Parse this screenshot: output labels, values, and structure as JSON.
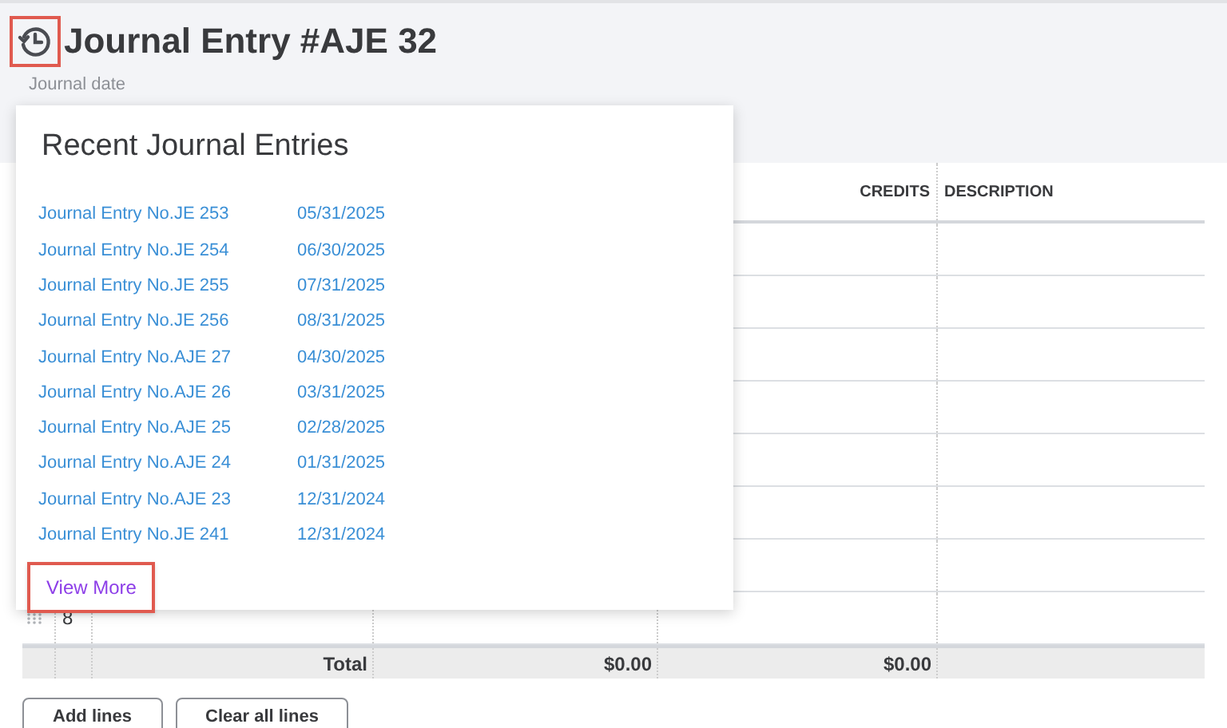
{
  "header": {
    "title": "Journal Entry #AJE 32",
    "date_label": "Journal date"
  },
  "recent_popup": {
    "title": "Recent Journal Entries",
    "entries": [
      {
        "name": "Journal Entry No.JE 253",
        "date": "05/31/2025"
      },
      {
        "name": "Journal Entry No.JE 254",
        "date": "06/30/2025"
      },
      {
        "name": "Journal Entry No.JE 255",
        "date": "07/31/2025"
      },
      {
        "name": "Journal Entry No.JE 256",
        "date": "08/31/2025"
      },
      {
        "name": "Journal Entry No.AJE 27",
        "date": "04/30/2025"
      },
      {
        "name": "Journal Entry No.AJE 26",
        "date": "03/31/2025"
      },
      {
        "name": "Journal Entry No.AJE 25",
        "date": "02/28/2025"
      },
      {
        "name": "Journal Entry No.AJE 24",
        "date": "01/31/2025"
      },
      {
        "name": "Journal Entry No.AJE 23",
        "date": "12/31/2024"
      },
      {
        "name": "Journal Entry No.JE 241",
        "date": "12/31/2024"
      }
    ],
    "view_more": "View More"
  },
  "table": {
    "columns": [
      "CREDITS",
      "DESCRIPTION"
    ],
    "visible_row": {
      "number": "8"
    },
    "total": {
      "label": "Total",
      "debits": "$0.00",
      "credits": "$0.00"
    }
  },
  "buttons": [
    "Add lines",
    "Clear all lines"
  ]
}
